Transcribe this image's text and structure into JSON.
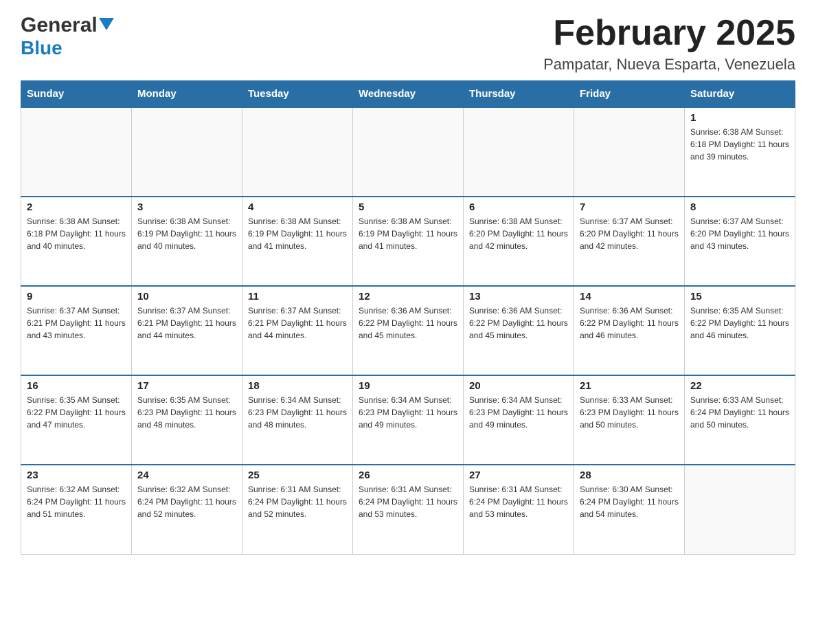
{
  "header": {
    "logo_general": "General",
    "logo_blue": "Blue",
    "month_title": "February 2025",
    "location": "Pampatar, Nueva Esparta, Venezuela"
  },
  "weekdays": [
    "Sunday",
    "Monday",
    "Tuesday",
    "Wednesday",
    "Thursday",
    "Friday",
    "Saturday"
  ],
  "weeks": [
    {
      "days": [
        {
          "number": "",
          "info": ""
        },
        {
          "number": "",
          "info": ""
        },
        {
          "number": "",
          "info": ""
        },
        {
          "number": "",
          "info": ""
        },
        {
          "number": "",
          "info": ""
        },
        {
          "number": "",
          "info": ""
        },
        {
          "number": "1",
          "info": "Sunrise: 6:38 AM\nSunset: 6:18 PM\nDaylight: 11 hours\nand 39 minutes."
        }
      ]
    },
    {
      "days": [
        {
          "number": "2",
          "info": "Sunrise: 6:38 AM\nSunset: 6:18 PM\nDaylight: 11 hours\nand 40 minutes."
        },
        {
          "number": "3",
          "info": "Sunrise: 6:38 AM\nSunset: 6:19 PM\nDaylight: 11 hours\nand 40 minutes."
        },
        {
          "number": "4",
          "info": "Sunrise: 6:38 AM\nSunset: 6:19 PM\nDaylight: 11 hours\nand 41 minutes."
        },
        {
          "number": "5",
          "info": "Sunrise: 6:38 AM\nSunset: 6:19 PM\nDaylight: 11 hours\nand 41 minutes."
        },
        {
          "number": "6",
          "info": "Sunrise: 6:38 AM\nSunset: 6:20 PM\nDaylight: 11 hours\nand 42 minutes."
        },
        {
          "number": "7",
          "info": "Sunrise: 6:37 AM\nSunset: 6:20 PM\nDaylight: 11 hours\nand 42 minutes."
        },
        {
          "number": "8",
          "info": "Sunrise: 6:37 AM\nSunset: 6:20 PM\nDaylight: 11 hours\nand 43 minutes."
        }
      ]
    },
    {
      "days": [
        {
          "number": "9",
          "info": "Sunrise: 6:37 AM\nSunset: 6:21 PM\nDaylight: 11 hours\nand 43 minutes."
        },
        {
          "number": "10",
          "info": "Sunrise: 6:37 AM\nSunset: 6:21 PM\nDaylight: 11 hours\nand 44 minutes."
        },
        {
          "number": "11",
          "info": "Sunrise: 6:37 AM\nSunset: 6:21 PM\nDaylight: 11 hours\nand 44 minutes."
        },
        {
          "number": "12",
          "info": "Sunrise: 6:36 AM\nSunset: 6:22 PM\nDaylight: 11 hours\nand 45 minutes."
        },
        {
          "number": "13",
          "info": "Sunrise: 6:36 AM\nSunset: 6:22 PM\nDaylight: 11 hours\nand 45 minutes."
        },
        {
          "number": "14",
          "info": "Sunrise: 6:36 AM\nSunset: 6:22 PM\nDaylight: 11 hours\nand 46 minutes."
        },
        {
          "number": "15",
          "info": "Sunrise: 6:35 AM\nSunset: 6:22 PM\nDaylight: 11 hours\nand 46 minutes."
        }
      ]
    },
    {
      "days": [
        {
          "number": "16",
          "info": "Sunrise: 6:35 AM\nSunset: 6:22 PM\nDaylight: 11 hours\nand 47 minutes."
        },
        {
          "number": "17",
          "info": "Sunrise: 6:35 AM\nSunset: 6:23 PM\nDaylight: 11 hours\nand 48 minutes."
        },
        {
          "number": "18",
          "info": "Sunrise: 6:34 AM\nSunset: 6:23 PM\nDaylight: 11 hours\nand 48 minutes."
        },
        {
          "number": "19",
          "info": "Sunrise: 6:34 AM\nSunset: 6:23 PM\nDaylight: 11 hours\nand 49 minutes."
        },
        {
          "number": "20",
          "info": "Sunrise: 6:34 AM\nSunset: 6:23 PM\nDaylight: 11 hours\nand 49 minutes."
        },
        {
          "number": "21",
          "info": "Sunrise: 6:33 AM\nSunset: 6:23 PM\nDaylight: 11 hours\nand 50 minutes."
        },
        {
          "number": "22",
          "info": "Sunrise: 6:33 AM\nSunset: 6:24 PM\nDaylight: 11 hours\nand 50 minutes."
        }
      ]
    },
    {
      "days": [
        {
          "number": "23",
          "info": "Sunrise: 6:32 AM\nSunset: 6:24 PM\nDaylight: 11 hours\nand 51 minutes."
        },
        {
          "number": "24",
          "info": "Sunrise: 6:32 AM\nSunset: 6:24 PM\nDaylight: 11 hours\nand 52 minutes."
        },
        {
          "number": "25",
          "info": "Sunrise: 6:31 AM\nSunset: 6:24 PM\nDaylight: 11 hours\nand 52 minutes."
        },
        {
          "number": "26",
          "info": "Sunrise: 6:31 AM\nSunset: 6:24 PM\nDaylight: 11 hours\nand 53 minutes."
        },
        {
          "number": "27",
          "info": "Sunrise: 6:31 AM\nSunset: 6:24 PM\nDaylight: 11 hours\nand 53 minutes."
        },
        {
          "number": "28",
          "info": "Sunrise: 6:30 AM\nSunset: 6:24 PM\nDaylight: 11 hours\nand 54 minutes."
        },
        {
          "number": "",
          "info": ""
        }
      ]
    }
  ]
}
